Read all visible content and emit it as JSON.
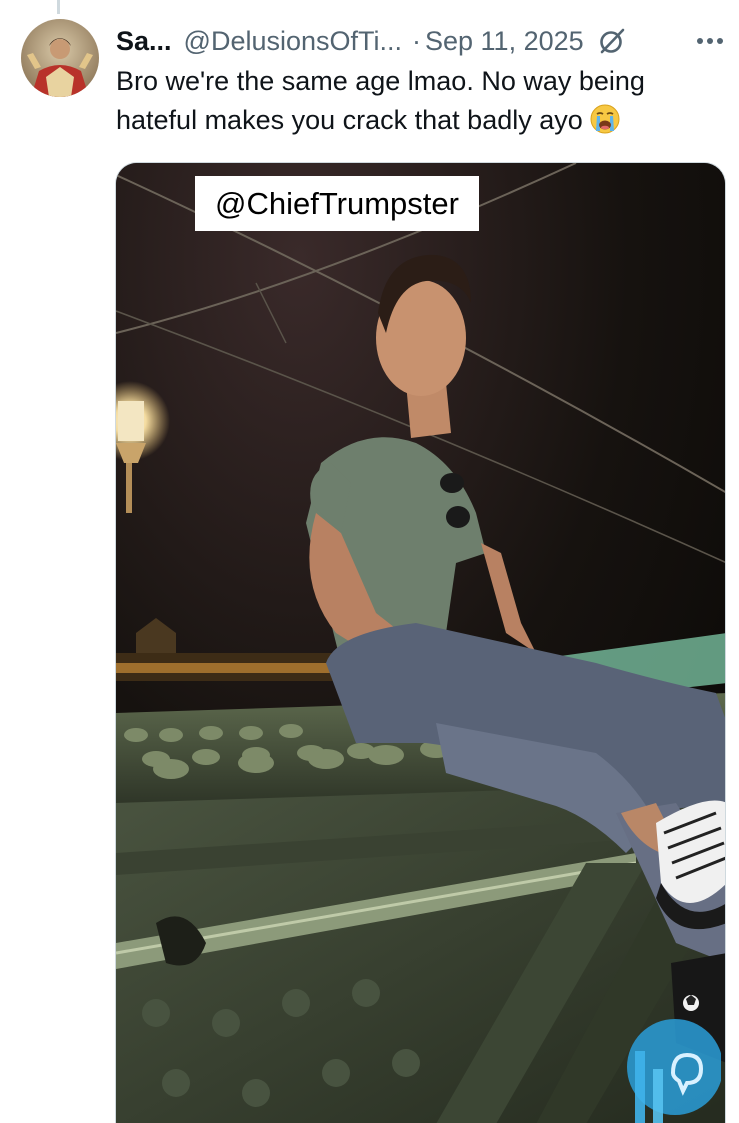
{
  "tweet": {
    "display_name": "Sa...",
    "handle": "@DelusionsOfTi...",
    "separator": "·",
    "date": "Sep 11, 2025",
    "text": "Bro we're the same age lmao. No way being hateful makes you crack that badly ayo",
    "emoji": "loudly-crying-face",
    "icons": {
      "avatar": "avatar",
      "grok": "grok-icon",
      "more": "more-options-icon"
    }
  },
  "media": {
    "caption_overlay": "@ChiefTrumpster",
    "watermark_icon": "watermark-logo-icon"
  },
  "colors": {
    "secondary_text": "#536471",
    "primary_text": "#0f1419",
    "border": "#cfd9de",
    "watermark": "#2a9dd8"
  }
}
